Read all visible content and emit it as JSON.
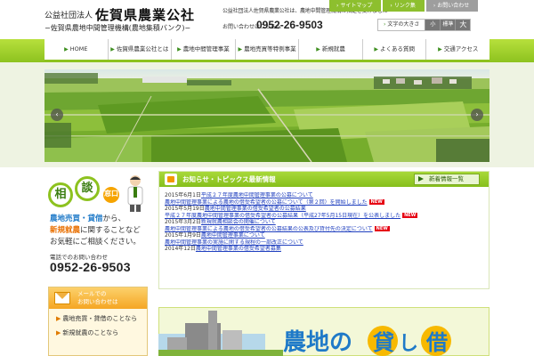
{
  "header": {
    "org_prefix": "公益社団法人",
    "org_name": "佐賀県農業公社",
    "org_sub": "−佐賀県農地中間管理機構(農地集積バンク)−",
    "notice": "公益社団法人佐賀県農業公社は、農地中間管理機構の指定を受けました",
    "tel_label": "お問い合わせはこちらへ",
    "tel": "0952-26-9503"
  },
  "topnav": [
    {
      "label": "サイトマップ"
    },
    {
      "label": "リンク集"
    },
    {
      "label": "お問い合わせ"
    }
  ],
  "fontsize": {
    "label": "文字の大きさ",
    "small": "小",
    "medium": "標準",
    "large": "大"
  },
  "gnav": [
    {
      "label": "HOME"
    },
    {
      "label": "佐賀県農業公社とは"
    },
    {
      "label": "農地中間管理事業"
    },
    {
      "label": "農地売買等特例事業"
    },
    {
      "label": "新規就農"
    },
    {
      "label": "よくある質問"
    },
    {
      "label": "交通アクセス"
    }
  ],
  "sidebar": {
    "sodan_chars": [
      "相",
      "談",
      "窓口"
    ],
    "line1_a": "農地売買・貸借",
    "line1_b": "から、",
    "line2_a": "新規就農",
    "line2_b": "に関することなど",
    "line3": "お気軽にご相談ください。",
    "tel_label": "電話でのお問い合わせ",
    "tel": "0952-26-9503",
    "mail_line1": "メールでの",
    "mail_line2": "お問い合わせは",
    "mail_links": [
      {
        "label": "農地売買・貸借のことなら"
      },
      {
        "label": "新規就農のことなら"
      }
    ]
  },
  "topics": {
    "title": "お知らせ・トピックス最新情報",
    "more": "新着情報一覧",
    "items": [
      {
        "date": "2015年6月1日",
        "title": "平成２７年度農地中間管理事業の公募について",
        "link": "農地中間管理事業による農地の借受希望者の公募について（第２回）を開始しました",
        "new": "NEW"
      },
      {
        "date": "2015年5月19日",
        "title": "農地中間管理事業の借受希望者の公募結果",
        "link": "平成２７年度農地中間管理事業の借受希望者の公募結果（平成27年5月15日現在）を公表しました",
        "new": "NEW"
      },
      {
        "date": "2015年3月2日",
        "title": "新規就農相談会の開催について",
        "link": "農地中間管理事業による農地の借受希望者の公募結果の公表及び貸付先の決定について",
        "new": "NEW"
      },
      {
        "date": "2015年1月9日",
        "title": "農地中間管理事業について",
        "link": "農地中間管理事業の実施に関する規程の一部改正について",
        "new": ""
      },
      {
        "date": "2014年12日",
        "title": "農地中間管理事業の借受希望者募集",
        "link": "",
        "new": ""
      }
    ]
  },
  "banner": {
    "text_a": "農地の",
    "text_b": "貸",
    "text_c": "し",
    "text_d": "借"
  }
}
